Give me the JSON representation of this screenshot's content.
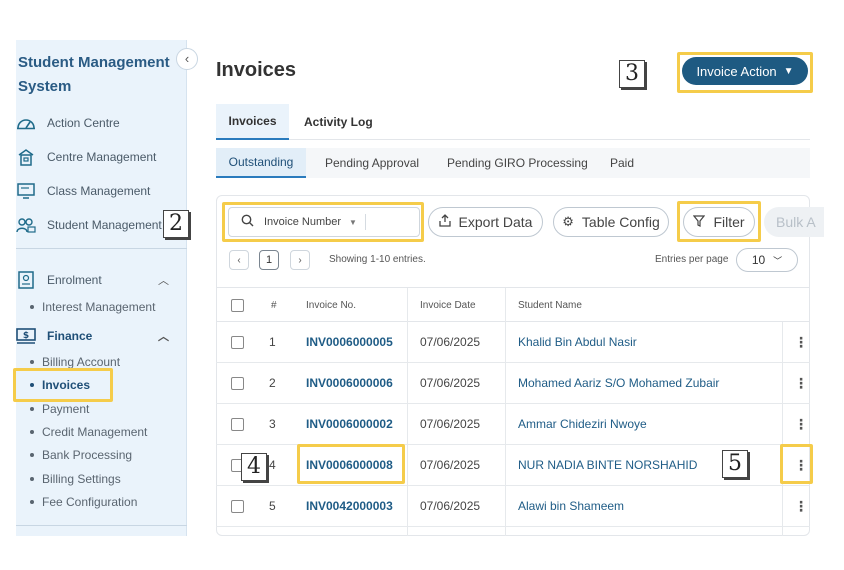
{
  "sidebar": {
    "brand": "Student Management System",
    "collapse_icon": "‹",
    "items": [
      {
        "label": "Action Centre",
        "icon": "gauge-icon"
      },
      {
        "label": "Centre Management",
        "icon": "building-icon"
      },
      {
        "label": "Class Management",
        "icon": "class-icon"
      },
      {
        "label": "Student Management",
        "icon": "students-icon"
      },
      {
        "label": "Enrolment",
        "icon": "enrolment-icon"
      },
      {
        "label": "Finance",
        "icon": "dollar-icon"
      }
    ],
    "enrolment_sub": [
      "Interest Management"
    ],
    "finance_sub": [
      "Billing Account",
      "Invoices",
      "Payment",
      "Credit Management",
      "Bank Processing",
      "Billing Settings",
      "Fee Configuration"
    ]
  },
  "header": {
    "title": "Invoices",
    "action_button": "Invoice Action"
  },
  "tabs": [
    "Invoices",
    "Activity Log"
  ],
  "subtabs": [
    "Outstanding",
    "Pending Approval",
    "Pending GIRO Processing",
    "Paid"
  ],
  "toolbar": {
    "search_field": "Invoice Number",
    "export": "Export Data",
    "table_config": "Table Config",
    "filter": "Filter",
    "bulk": "Bulk A"
  },
  "pagination": {
    "prev": "‹",
    "page": "1",
    "next": "›",
    "showing": "Showing 1-10 entries.",
    "per_page_label": "Entries per page",
    "per_page": "10"
  },
  "table": {
    "headers": [
      "#",
      "Invoice No.",
      "Invoice Date",
      "Student Name"
    ],
    "rows": [
      {
        "num": "1",
        "invoice": "INV0006000005",
        "date": "07/06/2025",
        "student": "Khalid Bin Abdul Nasir"
      },
      {
        "num": "2",
        "invoice": "INV0006000006",
        "date": "07/06/2025",
        "student": "Mohamed Aariz S/O Mohamed Zubair"
      },
      {
        "num": "3",
        "invoice": "INV0006000002",
        "date": "07/06/2025",
        "student": "Ammar Chideziri Nwoye"
      },
      {
        "num": "4",
        "invoice": "INV0006000008",
        "date": "07/06/2025",
        "student": "NUR NADIA BINTE NORSHAHID"
      },
      {
        "num": "5",
        "invoice": "INV0042000003",
        "date": "07/06/2025",
        "student": "Alawi bin Shameem"
      }
    ]
  },
  "markers": [
    "2",
    "3",
    "4",
    "5"
  ]
}
